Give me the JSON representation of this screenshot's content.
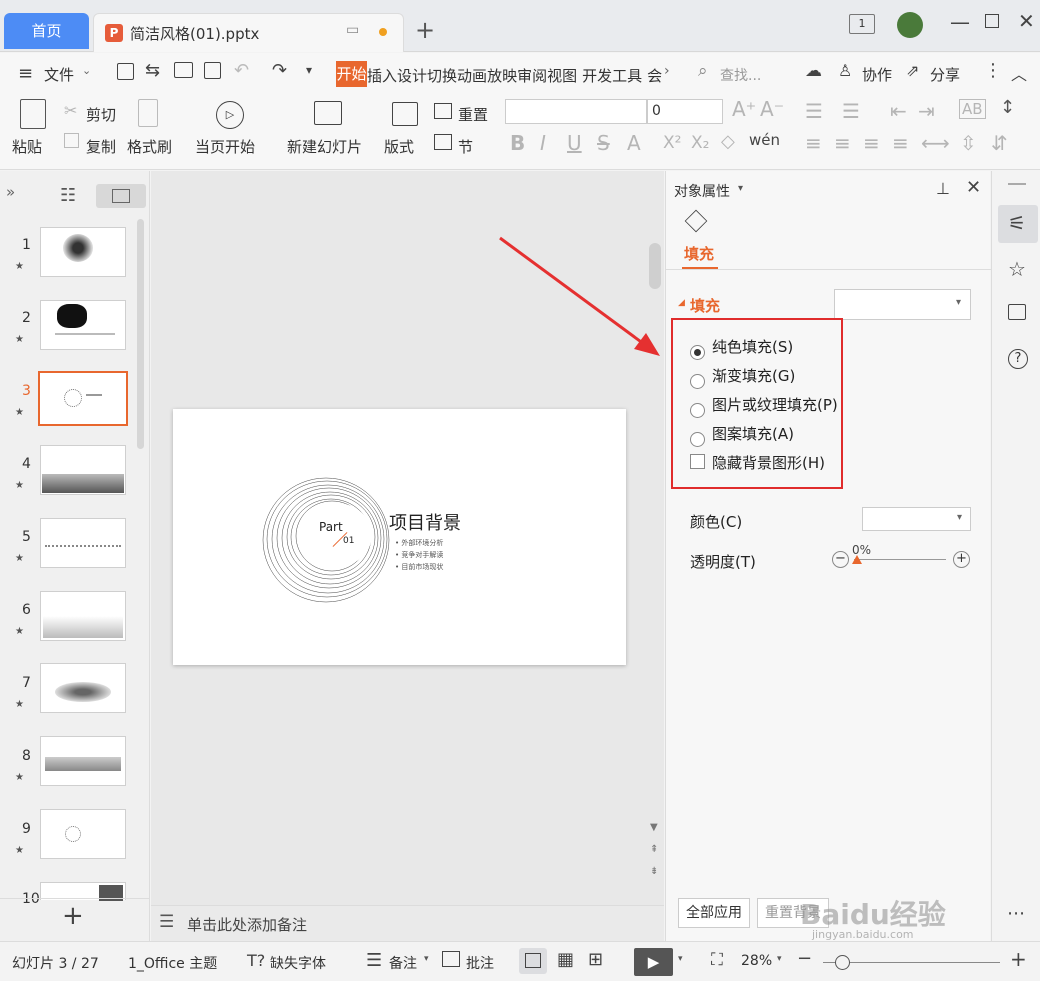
{
  "tabs": {
    "home": "首页",
    "doc": "简洁风格(01).pptx"
  },
  "menu": {
    "file": "文件",
    "start": "开始",
    "items": [
      "插入",
      "设计",
      "切换",
      "动画",
      "放映",
      "审阅",
      "视图",
      "开发工具",
      "会"
    ],
    "search": "查找...",
    "collab": "协作",
    "share": "分享"
  },
  "ribbon": {
    "paste": "粘贴",
    "cut": "剪切",
    "copy": "复制",
    "format_painter": "格式刷",
    "play_from_current": "当页开始",
    "new_slide": "新建幻灯片",
    "layout": "版式",
    "reset": "重置",
    "section": "节",
    "font_size": "0"
  },
  "thumbnails": [
    "1",
    "2",
    "3",
    "4",
    "5",
    "6",
    "7",
    "8",
    "9",
    "10"
  ],
  "slide": {
    "part": "Part",
    "num": "01",
    "title": "项目背景",
    "bullets": [
      "外部环境分析",
      "竞争对手解读",
      "目前市场现状"
    ]
  },
  "pane": {
    "title": "对象属性",
    "tab": "填充",
    "section": "填充",
    "options": [
      "纯色填充(S)",
      "渐变填充(G)",
      "图片或纹理填充(P)",
      "图案填充(A)"
    ],
    "hide_bg": "隐藏背景图形(H)",
    "color_label": "颜色(C)",
    "transparency_label": "透明度(T)",
    "transparency_value": "0%",
    "apply_all": "全部应用",
    "reset_bg": "重置背景"
  },
  "notes": "单击此处添加备注",
  "status": {
    "slide_info": "幻灯片 3 / 27",
    "theme": "1_Office 主题",
    "missing_font": "缺失字体",
    "notes": "备注",
    "comments": "批注",
    "zoom": "28%"
  },
  "watermark": {
    "brand": "Baidu经验",
    "url": "jingyan.baidu.com"
  },
  "colors": {
    "accent": "#e8672e",
    "highlight_box": "#e02c2c",
    "arrow": "#e53030",
    "home_tab": "#4d8cf5"
  }
}
